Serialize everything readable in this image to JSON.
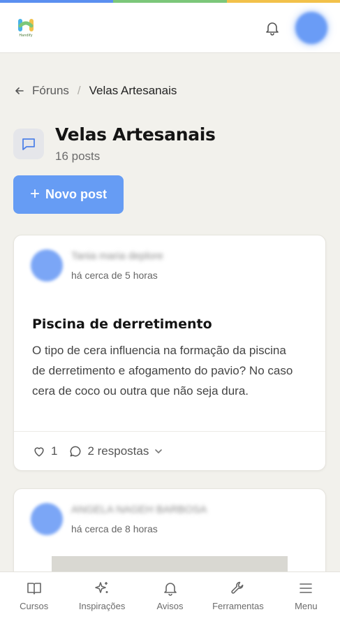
{
  "colors": {
    "strip": [
      "#5b8ff0",
      "#7cc77a",
      "#f2c14a"
    ],
    "primary": "#669cf4",
    "background": "#f2f1ec"
  },
  "header": {
    "logo_text": "Handify",
    "bell_icon": "bell-icon"
  },
  "breadcrumb": {
    "back_icon": "arrow-left-icon",
    "parent": "Fóruns",
    "separator": "/",
    "current": "Velas Artesanais"
  },
  "forum": {
    "icon": "chat-bubble-icon",
    "title": "Velas Artesanais",
    "post_count": "16 posts"
  },
  "new_post_button": {
    "icon": "+",
    "label": "Novo post"
  },
  "posts": [
    {
      "author": "Tania maria deplore",
      "time": "há cerca de 5 horas",
      "title": "Piscina de derretimento",
      "body": "O tipo de cera influencia na formação da piscina de derretimento e afogamento do pavio? No caso cera de coco ou outra que não seja dura.",
      "likes": "1",
      "replies": "2 respostas"
    },
    {
      "author": "ANGELA NAGEH BARBOSA",
      "time": "há cerca de 8 horas"
    }
  ],
  "bottom_nav": [
    {
      "icon": "book-icon",
      "label": "Cursos"
    },
    {
      "icon": "sparkles-icon",
      "label": "Inspirações"
    },
    {
      "icon": "bell-icon",
      "label": "Avisos"
    },
    {
      "icon": "wrench-icon",
      "label": "Ferramentas"
    },
    {
      "icon": "menu-icon",
      "label": "Menu"
    }
  ]
}
